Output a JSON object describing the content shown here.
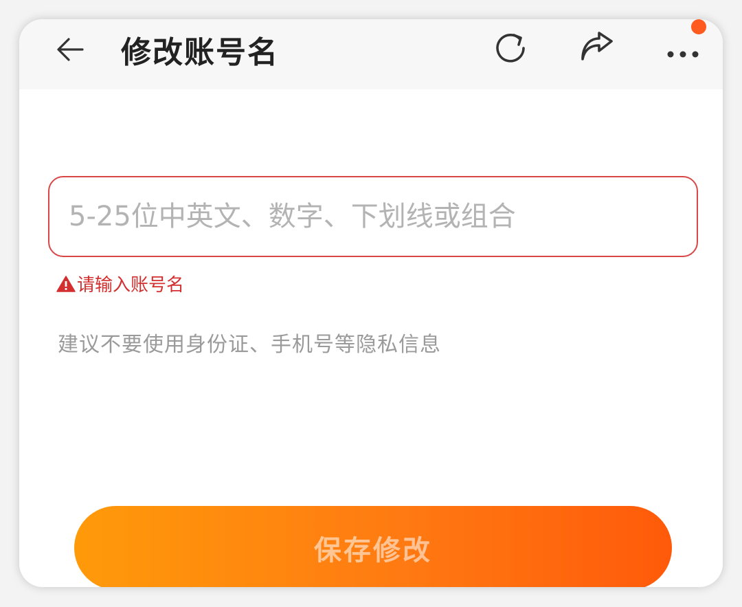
{
  "header": {
    "title": "修改账号名",
    "back_icon": "arrow-left-icon",
    "actions": [
      {
        "icon": "refresh-icon"
      },
      {
        "icon": "share-icon"
      },
      {
        "icon": "more-horizontal-icon"
      }
    ],
    "notification_dot_color": "#ff5a1f"
  },
  "form": {
    "account_name": {
      "value": "",
      "placeholder": "5-25位中英文、数字、下划线或组合",
      "border_color": "#d94646"
    },
    "error": {
      "icon": "warning-triangle-icon",
      "message": "请输入账号名",
      "color": "#d32f2f"
    },
    "hint": "建议不要使用身份证、手机号等隐私信息"
  },
  "footer": {
    "save_label": "保存修改",
    "gradient_start": "#ff9a0a",
    "gradient_end": "#ff5a0a"
  }
}
